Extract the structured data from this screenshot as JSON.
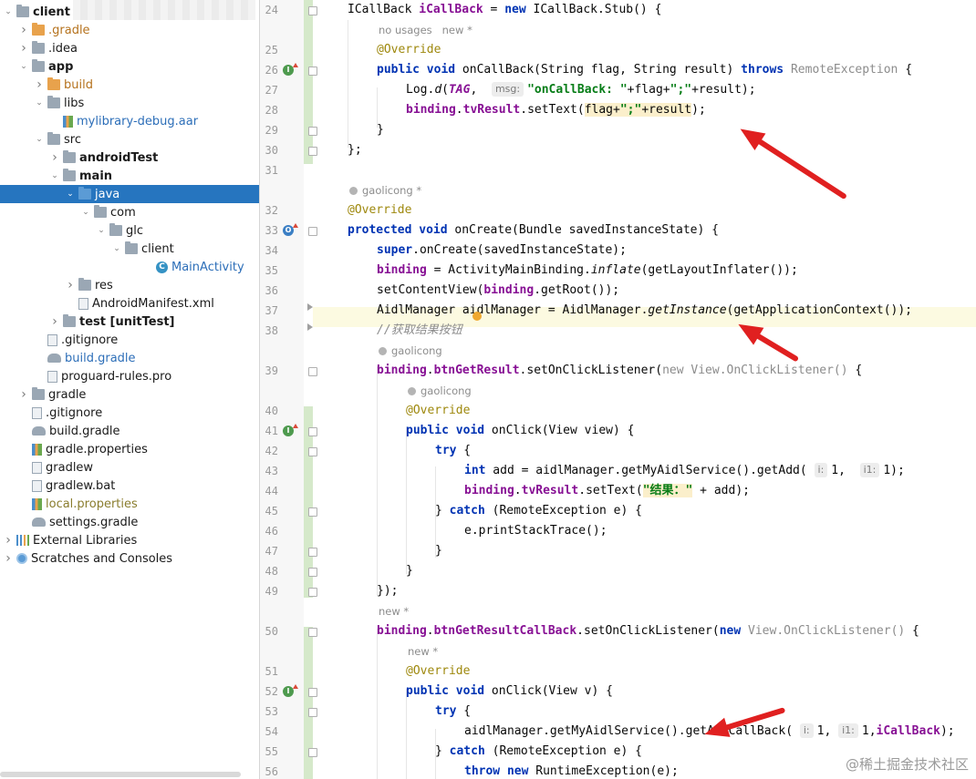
{
  "project_tree": {
    "items": [
      {
        "label": "client",
        "depth": 0,
        "arrow": "down",
        "icon": "folder-icon",
        "bold": true
      },
      {
        "label": ".gradle",
        "depth": 1,
        "arrow": "right",
        "icon": "folder-orange-icon",
        "color": "orange"
      },
      {
        "label": ".idea",
        "depth": 1,
        "arrow": "right",
        "icon": "folder-icon"
      },
      {
        "label": "app",
        "depth": 1,
        "arrow": "down",
        "icon": "module-folder-icon",
        "bold": true
      },
      {
        "label": "build",
        "depth": 2,
        "arrow": "right",
        "icon": "folder-orange-icon",
        "color": "orange"
      },
      {
        "label": "libs",
        "depth": 2,
        "arrow": "down",
        "icon": "folder-icon"
      },
      {
        "label": "mylibrary-debug.aar",
        "depth": 3,
        "arrow": "",
        "icon": "library-file-icon",
        "color": "blue"
      },
      {
        "label": "src",
        "depth": 2,
        "arrow": "down",
        "icon": "folder-icon"
      },
      {
        "label": "androidTest",
        "depth": 3,
        "arrow": "right",
        "icon": "folder-icon",
        "bold": true
      },
      {
        "label": "main",
        "depth": 3,
        "arrow": "down",
        "icon": "folder-icon",
        "bold": true
      },
      {
        "label": "java",
        "depth": 4,
        "arrow": "down",
        "icon": "source-folder-icon",
        "selected": true
      },
      {
        "label": "com",
        "depth": 5,
        "arrow": "down",
        "icon": "package-icon"
      },
      {
        "label": "glc",
        "depth": 6,
        "arrow": "down",
        "icon": "package-icon"
      },
      {
        "label": "client",
        "depth": 7,
        "arrow": "down",
        "icon": "package-icon"
      },
      {
        "label": "MainActivity",
        "depth": 9,
        "arrow": "",
        "icon": "class-icon",
        "color": "blue"
      },
      {
        "label": "res",
        "depth": 4,
        "arrow": "right",
        "icon": "resources-folder-icon"
      },
      {
        "label": "AndroidManifest.xml",
        "depth": 4,
        "arrow": "",
        "icon": "manifest-file-icon"
      },
      {
        "label": "test [unitTest]",
        "depth": 3,
        "arrow": "right",
        "icon": "folder-icon",
        "bold": true
      },
      {
        "label": ".gitignore",
        "depth": 2,
        "arrow": "",
        "icon": "file-icon"
      },
      {
        "label": "build.gradle",
        "depth": 2,
        "arrow": "",
        "icon": "gradle-icon",
        "color": "blue"
      },
      {
        "label": "proguard-rules.pro",
        "depth": 2,
        "arrow": "",
        "icon": "file-icon"
      },
      {
        "label": "gradle",
        "depth": 1,
        "arrow": "right",
        "icon": "folder-icon"
      },
      {
        "label": ".gitignore",
        "depth": 1,
        "arrow": "",
        "icon": "file-icon"
      },
      {
        "label": "build.gradle",
        "depth": 1,
        "arrow": "",
        "icon": "gradle-icon"
      },
      {
        "label": "gradle.properties",
        "depth": 1,
        "arrow": "",
        "icon": "properties-file-icon"
      },
      {
        "label": "gradlew",
        "depth": 1,
        "arrow": "",
        "icon": "file-icon"
      },
      {
        "label": "gradlew.bat",
        "depth": 1,
        "arrow": "",
        "icon": "file-icon"
      },
      {
        "label": "local.properties",
        "depth": 1,
        "arrow": "",
        "icon": "properties-file-icon",
        "color": "olive"
      },
      {
        "label": "settings.gradle",
        "depth": 1,
        "arrow": "",
        "icon": "gradle-icon"
      },
      {
        "label": "External Libraries",
        "depth": 0,
        "arrow": "right",
        "icon": "libraries-icon"
      },
      {
        "label": "Scratches and Consoles",
        "depth": 0,
        "arrow": "right",
        "icon": "scratches-icon"
      }
    ]
  },
  "editor": {
    "lines": [
      {
        "num": "24",
        "indent": 0,
        "html": "ICallBack <span class=\"fd\">iCallBack</span> = <span class=\"kw\">new</span> ICallBack.Stub() {"
      },
      {
        "meta": "no usages   new *",
        "indent": 1
      },
      {
        "num": "25",
        "indent": 1,
        "html": "<span class=\"an\">@Override</span>"
      },
      {
        "num": "26",
        "indent": 1,
        "gicon": "impl",
        "html": "<span class=\"kw\">public void</span> onCallBack(String flag, String result) <span class=\"kw\">throws</span> <span class=\"gy\">RemoteException</span> {"
      },
      {
        "num": "27",
        "indent": 2,
        "html": "Log.<span class=\"it\">d</span>(<span class=\"fd it\">TAG</span>,  <span class=\"hint\">msg:</span><span class=\"st\">\"onCallBack: \"</span>+flag+<span class=\"st\">\";\"</span>+result);"
      },
      {
        "num": "28",
        "indent": 2,
        "html": "<span class=\"fd\">binding</span>.<span class=\"fd\">tvResult</span>.setText(<span class=\"hl\">flag+<span class=\"st\">\";\"</span>+result</span>);"
      },
      {
        "num": "29",
        "indent": 1,
        "html": "}"
      },
      {
        "num": "30",
        "indent": 0,
        "html": "};"
      },
      {
        "num": "31",
        "indent": 0,
        "html": ""
      },
      {
        "meta": "gaolicong *",
        "person": true,
        "indent": 0
      },
      {
        "num": "32",
        "indent": 0,
        "html": "<span class=\"an\">@Override</span>"
      },
      {
        "num": "33",
        "indent": 0,
        "gicon": "ovr",
        "html": "<span class=\"kw\">protected void</span> onCreate(Bundle savedInstanceState) {"
      },
      {
        "num": "34",
        "indent": 1,
        "html": "<span class=\"kw\">super</span>.onCreate(savedInstanceState);"
      },
      {
        "num": "35",
        "indent": 1,
        "html": "<span class=\"fd\">binding</span> = ActivityMainBinding.<span class=\"it\">inflate</span>(getLayoutInflater());"
      },
      {
        "num": "36",
        "indent": 1,
        "html": "setContentView(<span class=\"fd\">binding</span>.getRoot());"
      },
      {
        "num": "37",
        "indent": 1,
        "current": true,
        "html": "AidlManager aidlManager = AidlManager.<span class=\"it\">getInstance</span>(getApplicationContext());"
      },
      {
        "num": "38",
        "indent": 1,
        "html": "<span class=\"cm\">//获取结果按钮</span>"
      },
      {
        "meta": "gaolicong",
        "person": true,
        "indent": 1
      },
      {
        "num": "39",
        "indent": 1,
        "html": "<span class=\"fd\">binding</span>.<span class=\"fd\">btnGetResult</span>.setOnClickListener(<span class=\"gy\">new View.OnClickListener()</span> {"
      },
      {
        "meta": "gaolicong",
        "person": true,
        "indent": 2
      },
      {
        "num": "40",
        "indent": 2,
        "html": "<span class=\"an\">@Override</span>"
      },
      {
        "num": "41",
        "indent": 2,
        "gicon": "impl",
        "html": "<span class=\"kw\">public void</span> onClick(View view) {"
      },
      {
        "num": "42",
        "indent": 3,
        "html": "<span class=\"kw\">try</span> {"
      },
      {
        "num": "43",
        "indent": 4,
        "html": "<span class=\"kw\">int</span> add = aidlManager.getMyAidlService().getAdd( <span class=\"hint\">i:</span>1,  <span class=\"hint\">i1:</span>1);"
      },
      {
        "num": "44",
        "indent": 4,
        "html": "<span class=\"fd\">binding</span>.<span class=\"fd\">tvResult</span>.setText(<span class=\"st hl\">\"结果：\"</span> + add);"
      },
      {
        "num": "45",
        "indent": 3,
        "html": "} <span class=\"kw\">catch</span> (RemoteException e) {"
      },
      {
        "num": "46",
        "indent": 4,
        "html": "e.printStackTrace();"
      },
      {
        "num": "47",
        "indent": 3,
        "html": "}"
      },
      {
        "num": "48",
        "indent": 2,
        "html": "}"
      },
      {
        "num": "49",
        "indent": 1,
        "html": "});"
      },
      {
        "meta": "new *",
        "indent": 1
      },
      {
        "num": "50",
        "indent": 1,
        "html": "<span class=\"fd\">binding</span>.<span class=\"fd\">btnGetResultCallBack</span>.setOnClickListener(<span class=\"kw\">new</span> <span class=\"gy\">View.OnClickListener()</span> {"
      },
      {
        "meta": "new *",
        "indent": 2
      },
      {
        "num": "51",
        "indent": 2,
        "html": "<span class=\"an\">@Override</span>"
      },
      {
        "num": "52",
        "indent": 2,
        "gicon": "impl",
        "html": "<span class=\"kw\">public void</span> onClick(View v) {"
      },
      {
        "num": "53",
        "indent": 3,
        "html": "<span class=\"kw\">try</span> {"
      },
      {
        "num": "54",
        "indent": 4,
        "html": "aidlManager.getMyAidlService().getAddCallBack( <span class=\"hint\">i:</span>1, <span class=\"hint\">i1:</span>1,<span class=\"fd\">iCallBack</span>);"
      },
      {
        "num": "55",
        "indent": 3,
        "html": "} <span class=\"kw\">catch</span> (RemoteException e) {"
      },
      {
        "num": "56",
        "indent": 4,
        "html": "<span class=\"kw\">throw new</span> RuntimeException(e);"
      }
    ]
  },
  "watermark": "@稀土掘金技术社区",
  "colors": {
    "selection": "#2675bf",
    "keyword": "#0033b3",
    "field": "#871094",
    "string": "#067d17",
    "annotation": "#9e880d",
    "arrow": "#e02020"
  }
}
